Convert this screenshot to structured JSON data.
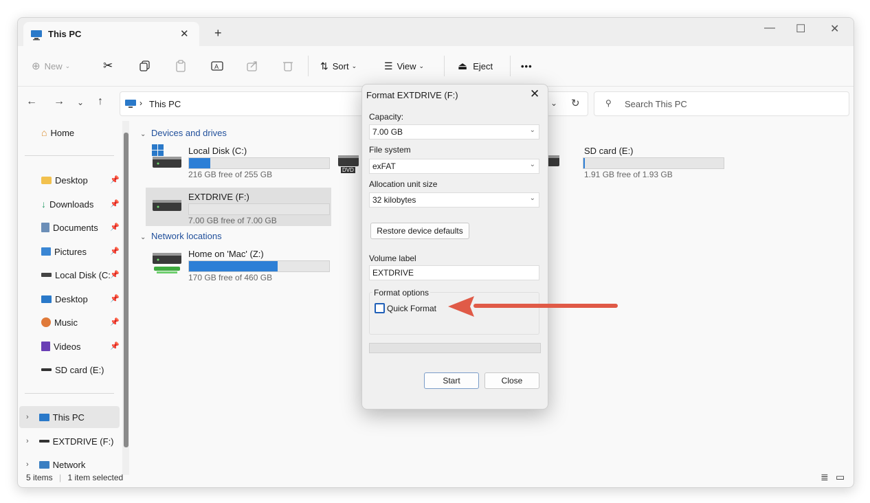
{
  "window": {
    "tab_title": "This PC"
  },
  "toolbar": {
    "new_label": "New",
    "sort_label": "Sort",
    "view_label": "View",
    "eject_label": "Eject",
    "more_label": "•••"
  },
  "address": {
    "path": "This PC",
    "search_placeholder": "Search This PC"
  },
  "sidebar": {
    "items": [
      {
        "label": "Home"
      },
      {
        "label": "Desktop"
      },
      {
        "label": "Downloads"
      },
      {
        "label": "Documents"
      },
      {
        "label": "Pictures"
      },
      {
        "label": "Local Disk (C:"
      },
      {
        "label": "Desktop"
      },
      {
        "label": "Music"
      },
      {
        "label": "Videos"
      },
      {
        "label": "SD card (E:)"
      }
    ],
    "tree": [
      {
        "label": "This PC"
      },
      {
        "label": "EXTDRIVE (F:)"
      },
      {
        "label": "Network"
      }
    ]
  },
  "content": {
    "devices_header": "Devices and drives",
    "network_header": "Network locations",
    "drives": [
      {
        "name": "Local Disk (C:)",
        "free": "216 GB free of 255 GB",
        "used_fraction": 0.15
      },
      {
        "name": "EXTDRIVE (F:)",
        "free": "7.00 GB free of 7.00 GB",
        "used_fraction": 0.0
      },
      {
        "name": "SD card (E:)",
        "free": "1.91 GB free of 1.93 GB",
        "used_fraction": 0.01
      },
      {
        "name": "Home on 'Mac' (Z:)",
        "free": "170 GB free of 460 GB",
        "used_fraction": 0.63
      }
    ],
    "dvd_label": "DVD"
  },
  "statusbar": {
    "items": "5 items",
    "selected": "1 item selected"
  },
  "dialog": {
    "title": "Format EXTDRIVE (F:)",
    "capacity_label": "Capacity:",
    "capacity_value": "7.00 GB",
    "filesystem_label": "File system",
    "filesystem_value": "exFAT",
    "alloc_label": "Allocation unit size",
    "alloc_value": "32 kilobytes",
    "restore_label": "Restore device defaults",
    "volume_label": "Volume label",
    "volume_value": "EXTDRIVE",
    "options_label": "Format options",
    "quick_format_label": "Quick Format",
    "start_label": "Start",
    "close_label": "Close"
  },
  "colors": {
    "accent": "#2d7fd6",
    "annotation_arrow": "#e05a47"
  }
}
